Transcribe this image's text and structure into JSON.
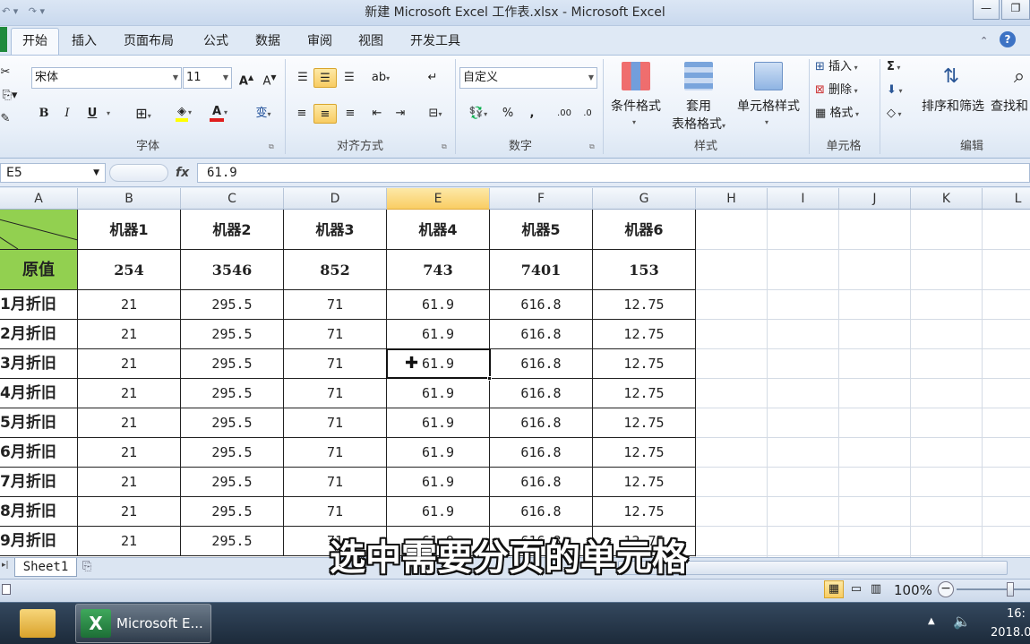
{
  "window": {
    "title": "新建 Microsoft Excel 工作表.xlsx - Microsoft Excel"
  },
  "tabs": [
    "开始",
    "插入",
    "页面布局",
    "公式",
    "数据",
    "审阅",
    "视图",
    "开发工具"
  ],
  "ribbon": {
    "font_name": "宋体",
    "font_size": "11",
    "number_format": "自定义",
    "bold": "B",
    "italic": "I",
    "underline": "U",
    "percent": "%",
    "comma": ",",
    "sum": "Σ",
    "groups": [
      "字体",
      "对齐方式",
      "数字",
      "样式",
      "单元格",
      "编辑"
    ],
    "conditional_format": "条件格式",
    "table_format_line1": "套用",
    "table_format_line2": "表格格式",
    "cell_styles": "单元格样式",
    "insert": "插入",
    "delete": "删除",
    "format": "格式",
    "sort_filter": "排序和筛选",
    "find_select": "查找和"
  },
  "formula_bar": {
    "name_box": "E5",
    "fx": "fx",
    "value": "61.9"
  },
  "columns": [
    "A",
    "B",
    "C",
    "D",
    "E",
    "F",
    "G",
    "H",
    "I",
    "J",
    "K",
    "L"
  ],
  "active_column": "E",
  "table": {
    "header": [
      "机器1",
      "机器2",
      "机器3",
      "机器4",
      "机器5",
      "机器6"
    ],
    "original_label": "原值",
    "original_values": [
      "254",
      "3546",
      "852",
      "743",
      "7401",
      "153"
    ],
    "rows": [
      {
        "label": "1月折旧",
        "values": [
          "21",
          "295.5",
          "71",
          "61.9",
          "616.8",
          "12.75"
        ]
      },
      {
        "label": "2月折旧",
        "values": [
          "21",
          "295.5",
          "71",
          "61.9",
          "616.8",
          "12.75"
        ]
      },
      {
        "label": "3月折旧",
        "values": [
          "21",
          "295.5",
          "71",
          "61.9",
          "616.8",
          "12.75"
        ]
      },
      {
        "label": "4月折旧",
        "values": [
          "21",
          "295.5",
          "71",
          "61.9",
          "616.8",
          "12.75"
        ]
      },
      {
        "label": "5月折旧",
        "values": [
          "21",
          "295.5",
          "71",
          "61.9",
          "616.8",
          "12.75"
        ]
      },
      {
        "label": "6月折旧",
        "values": [
          "21",
          "295.5",
          "71",
          "61.9",
          "616.8",
          "12.75"
        ]
      },
      {
        "label": "7月折旧",
        "values": [
          "21",
          "295.5",
          "71",
          "61.9",
          "616.8",
          "12.75"
        ]
      },
      {
        "label": "8月折旧",
        "values": [
          "21",
          "295.5",
          "71",
          "61.9",
          "616.8",
          "12.75"
        ]
      },
      {
        "label": "9月折旧",
        "values": [
          "21",
          "295.5",
          "71",
          "61.9",
          "616.8",
          "12.75"
        ]
      }
    ]
  },
  "sheet_tab": "Sheet1",
  "status": {
    "zoom": "100%"
  },
  "taskbar": {
    "excel_label": "Microsoft E...",
    "time": "16:",
    "date": "2018.0"
  },
  "subtitle": "选中需要分页的单元格",
  "colors": {
    "header_fill": "#92d050",
    "active_header": "#f9cd63",
    "ribbon_bg": "#e9f0f9"
  }
}
